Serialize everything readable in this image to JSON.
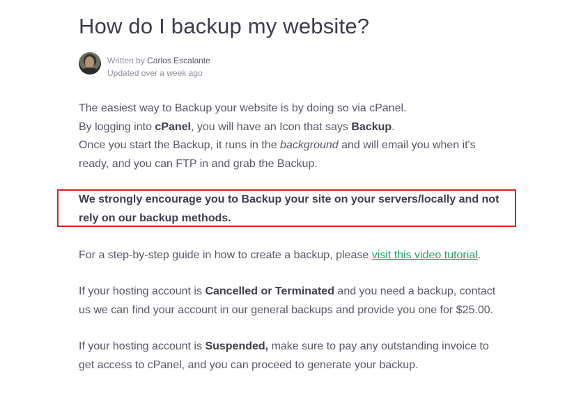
{
  "article": {
    "title": "How do I backup my website?",
    "author": {
      "written_by": "Written by ",
      "name": "Carlos Escalante",
      "updated": "Updated over a week ago"
    },
    "p1": {
      "l1": "The easiest way to Backup your website is by doing so via cPanel.",
      "l2_a": "By logging into ",
      "l2_b": "cPanel",
      "l2_c": ", you will have an Icon that says ",
      "l2_d": "Backup",
      "l2_e": ".",
      "l3_a": "Once you start the Backup, it runs in the ",
      "l3_b": "background",
      "l3_c": " and will email you when it's",
      "l4": "ready, and you can FTP in and grab the Backup."
    },
    "p2": {
      "l1": "We strongly encourage you to Backup your site on your servers/locally and not",
      "l2": "rely on our backup methods."
    },
    "p3": {
      "a": "For a step-by-step guide in how to create a backup, please ",
      "link": "visit this video tutorial",
      "b": "."
    },
    "p4": {
      "l1_a": "If your hosting account is ",
      "l1_b": "Cancelled or Terminated",
      "l1_c": " and you need a backup, contact",
      "l2": "us we can find your account in our general backups and provide you one for $25.00."
    },
    "p5": {
      "l1_a": "If your hosting account is ",
      "l1_b": "Suspended,",
      "l1_c": " make sure to pay any outstanding invoice to",
      "l2": "get access to cPanel, and you can proceed to generate your backup."
    }
  },
  "colors": {
    "highlight_border": "#e31c1c",
    "link": "#17a95e",
    "text": "#565867"
  },
  "icons": {
    "avatar": "author-avatar-photo"
  }
}
